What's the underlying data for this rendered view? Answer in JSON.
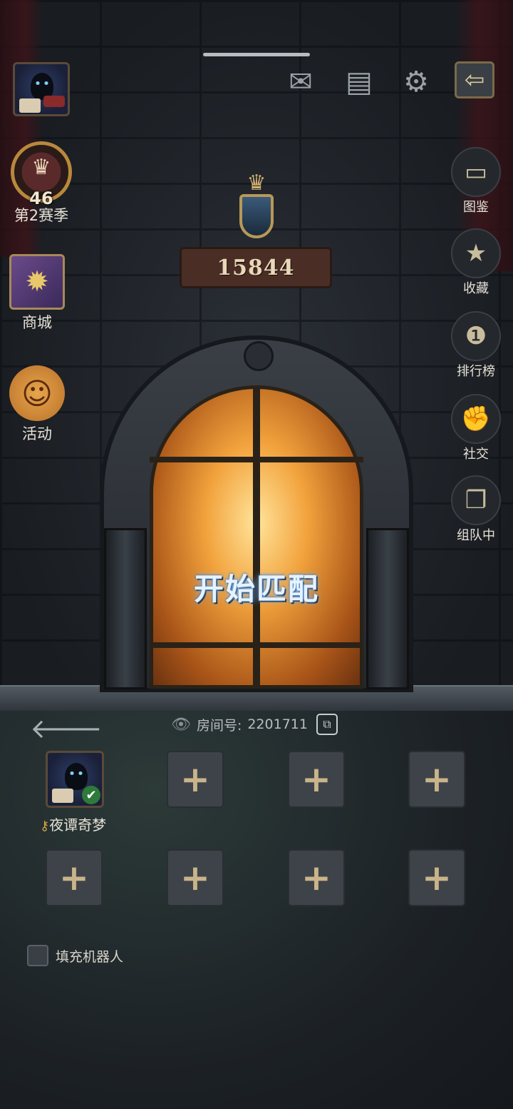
{
  "header": {
    "mail_icon": "mail-icon",
    "notes_icon": "notes-icon",
    "settings_icon": "gear-icon",
    "exit_icon": "exit-arrow-icon"
  },
  "left_menu": {
    "season": {
      "level": "46",
      "label": "第2赛季"
    },
    "shop": {
      "label": "商城"
    },
    "events": {
      "label": "活动"
    }
  },
  "right_menu": [
    {
      "label": "图鉴",
      "icon": "books-icon"
    },
    {
      "label": "收藏",
      "icon": "star-card-icon"
    },
    {
      "label": "排行榜",
      "icon": "podium-icon"
    },
    {
      "label": "社交",
      "icon": "fist-icon"
    },
    {
      "label": "组队中",
      "icon": "team-cards-icon"
    }
  ],
  "rank": {
    "score": "15844"
  },
  "door": {
    "start_label": "开始匹配"
  },
  "room": {
    "label": "房间号:",
    "id": "2201711"
  },
  "team": {
    "member_name": "夜谭奇梦",
    "empty_slot_count": 7
  },
  "options": {
    "fill_bots_label": "填充机器人",
    "fill_bots_checked": false
  },
  "colors": {
    "accent_gold": "#c9b48a",
    "door_glow": "#f2a23c",
    "start_text_glow": "#7ab8ff"
  }
}
